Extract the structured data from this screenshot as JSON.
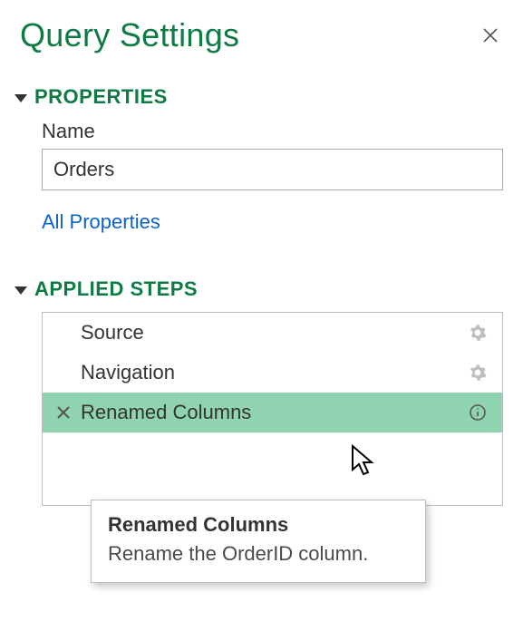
{
  "header": {
    "title": "Query Settings"
  },
  "properties": {
    "section_label": "PROPERTIES",
    "name_label": "Name",
    "name_value": "Orders",
    "all_properties_link": "All Properties"
  },
  "steps": {
    "section_label": "APPLIED STEPS",
    "items": [
      {
        "label": "Source",
        "has_gear": true,
        "has_info": false,
        "selected": false
      },
      {
        "label": "Navigation",
        "has_gear": true,
        "has_info": false,
        "selected": false
      },
      {
        "label": "Renamed Columns",
        "has_gear": false,
        "has_info": true,
        "selected": true
      }
    ]
  },
  "tooltip": {
    "title": "Renamed Columns",
    "description": "Rename the OrderID column."
  }
}
